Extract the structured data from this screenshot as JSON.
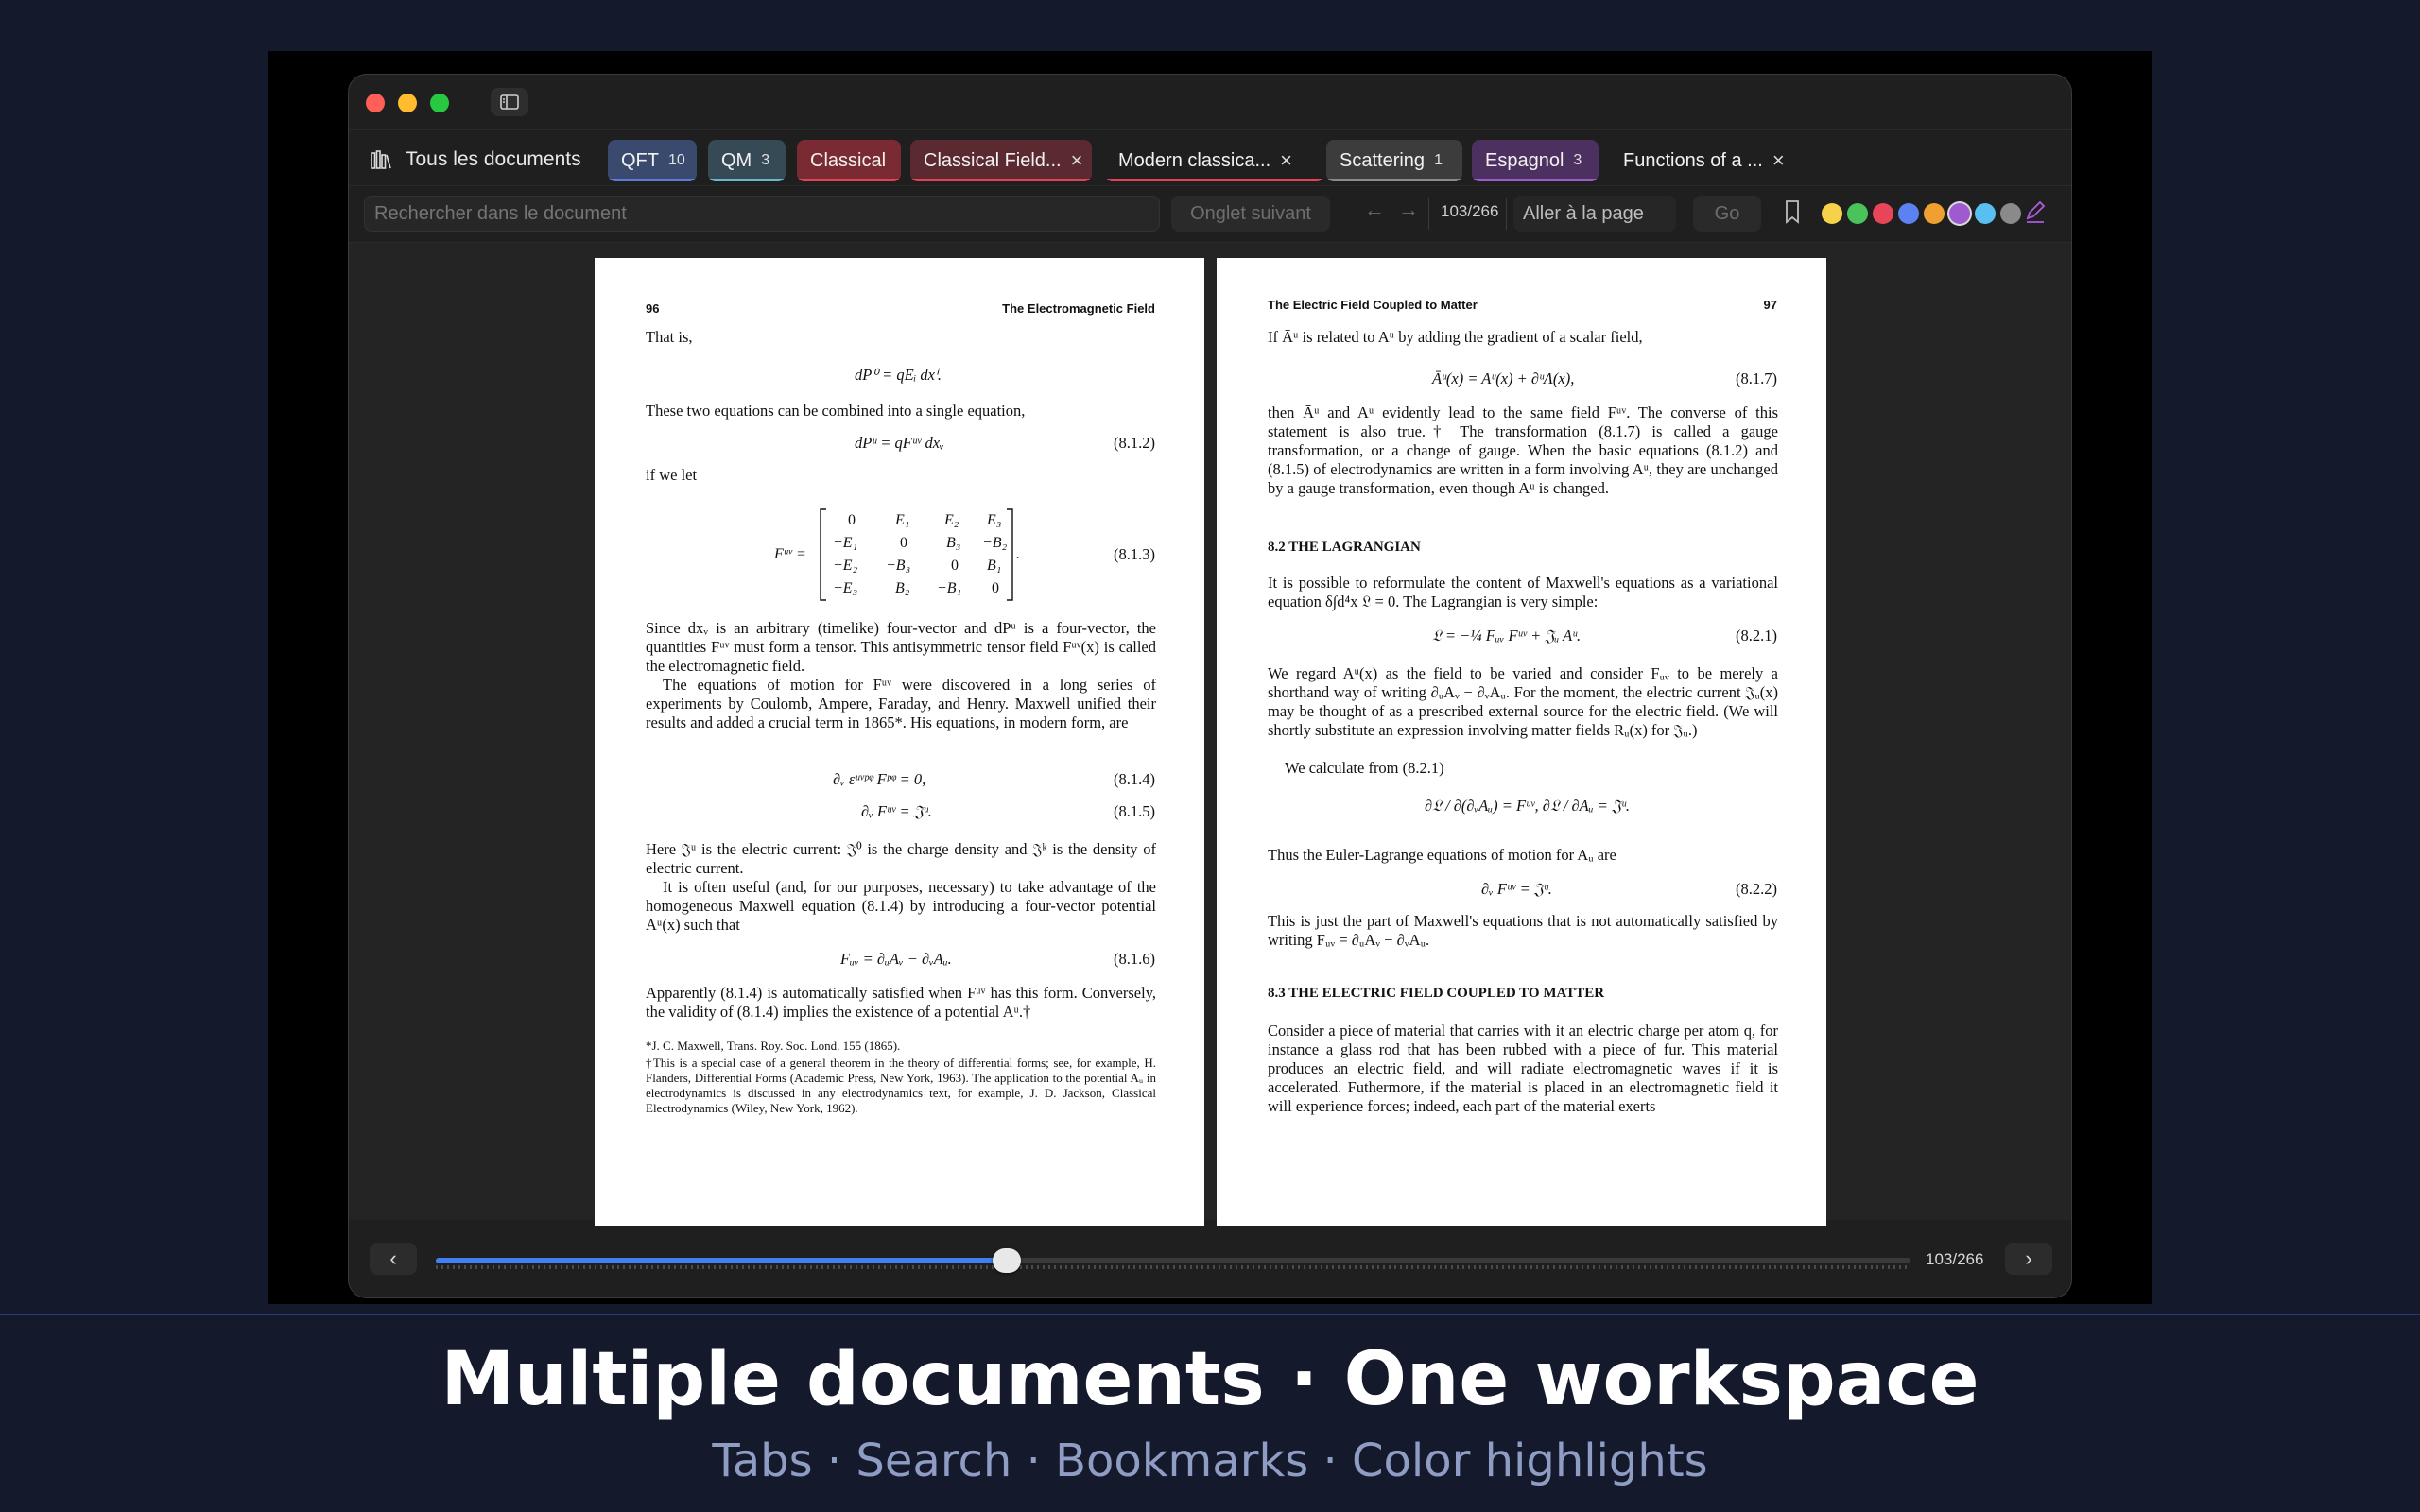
{
  "window": {
    "tabs_bar": {
      "all_docs_label": "Tous les documents",
      "tabs": [
        {
          "label": "QFT",
          "count": "10",
          "color": "#3a4a6e",
          "underline": "#5d7bd8"
        },
        {
          "label": "QM",
          "count": "3",
          "color": "#364a55",
          "underline": "#6ab8cf"
        },
        {
          "label": "Classical",
          "color": "#7a2a32",
          "underline": "#e04455"
        },
        {
          "label": "Classical Field...",
          "close": "×",
          "color": "#5a2a30",
          "underline": "#e04455"
        },
        {
          "label": "Modern classica...",
          "close": "×",
          "color": "transparent",
          "underline": "#e04455"
        },
        {
          "label": "Scattering",
          "count": "1",
          "color": "#3c3c3c",
          "underline": "#8a8a8a"
        },
        {
          "label": "Espagnol",
          "count": "3",
          "color": "#4c3060",
          "underline": "#a05ad0"
        },
        {
          "label": "Functions of a ...",
          "close": "×",
          "color": "transparent",
          "underline": "transparent"
        }
      ]
    },
    "toolbar": {
      "search_placeholder": "Rechercher dans le document",
      "next_tab_label": "Onglet suivant",
      "page_count": "103/266",
      "goto_placeholder": "Aller à la page",
      "go_label": "Go",
      "highlight_colors": [
        "#f5d24a",
        "#4cc35a",
        "#e8445a",
        "#5b82f0",
        "#f0a030",
        "#a05ad0",
        "#58c0f0",
        "#8a8a8a"
      ],
      "selected_color_index": 5
    },
    "pages": {
      "left": {
        "number": "96",
        "running_head": "The Electromagnetic Field",
        "t1": "That is,",
        "eq1": "dP⁰ = qEᵢ dxⁱ.",
        "t2": "These two equations can be combined into a single equation,",
        "eq2": "dPᵘ = qFᵘᵛ dxᵥ",
        "eq2n": "(8.1.2)",
        "t3": "if we let",
        "eq3n": "(8.1.3)",
        "t4": "Since dxᵥ is an arbitrary (timelike) four-vector and dPᵘ is a four-vector, the quantities Fᵘᵛ must form a tensor. This antisymmetric tensor field Fᵘᵛ(x) is called the electromagnetic field.",
        "t5": "The equations of motion for Fᵘᵛ were discovered in a long series of experiments by Coulomb, Ampere, Faraday, and Henry. Maxwell unified their results and added a crucial term in 1865*. His equations, in modern form, are",
        "eq4": "∂ᵥ εᵘᵛᵖᵠ Fᵖᵠ = 0,",
        "eq4n": "(8.1.4)",
        "eq5": "∂ᵥ Fᵘᵛ = 𝔍ᵘ.",
        "eq5n": "(8.1.5)",
        "t6": "Here 𝔍ᵘ is the electric current: 𝔍⁰ is the charge density and 𝔍ᵏ is the density of electric current.",
        "t7": "It is often useful (and, for our purposes, necessary) to take advantage of the homogeneous Maxwell equation (8.1.4) by introducing a four-vector potential Aᵘ(x) such that",
        "eq6": "Fᵤᵥ = ∂ᵤAᵥ − ∂ᵥAᵤ.",
        "eq6n": "(8.1.6)",
        "t8": "Apparently (8.1.4) is automatically satisfied when Fᵘᵛ has this form. Conversely, the validity of (8.1.4) implies the existence of a potential Aᵘ.†",
        "fn1": "*J. C. Maxwell, Trans. Roy. Soc. Lond. 155 (1865).",
        "fn2": "†This is a special case of a general theorem in the theory of differential forms; see, for example, H. Flanders, Differential Forms (Academic Press, New York, 1963). The application to the potential Aᵤ in electrodynamics is discussed in any electrodynamics text, for example, J. D. Jackson, Classical Electrodynamics (Wiley, New York, 1962)."
      },
      "right": {
        "number": "97",
        "running_head": "The Electric Field Coupled to Matter",
        "t1": "If Āᵘ is related to Aᵘ by adding the gradient of a scalar field,",
        "eq1": "Āᵘ(x) = Aᵘ(x) + ∂ᵘΛ(x),",
        "eq1n": "(8.1.7)",
        "t2": "then Āᵘ and Aᵘ evidently lead to the same field Fᵘᵛ. The converse of this statement is also true.† The transformation (8.1.7) is called a gauge transformation, or a change of gauge. When the basic equations (8.1.2) and (8.1.5) of electrodynamics are written in a form involving Aᵘ, they are unchanged by a gauge transformation, even though Aᵘ is changed.",
        "s1": "8.2   THE LAGRANGIAN",
        "t3": "It is possible to reformulate the content of Maxwell's equations as a variational equation δ∫d⁴x 𝔏 = 0. The Lagrangian is very simple:",
        "eq2": "𝔏 = −¼ Fᵤᵥ Fᵘᵛ + 𝔍ᵤ Aᵘ.",
        "eq2n": "(8.2.1)",
        "t4": "We regard Aᵘ(x) as the field to be varied and consider Fᵤᵥ to be merely a shorthand way of writing ∂ᵤAᵥ − ∂ᵥAᵤ. For the moment, the electric current 𝔍ᵤ(x) may be thought of as a prescribed external source for the electric field. (We will shortly substitute an expression involving matter fields Rᵤ(x) for 𝔍ᵤ.)",
        "t5": "We calculate from (8.2.1)",
        "eq3": "∂𝔏 / ∂(∂ᵥAᵤ) = Fᵘᵛ,    ∂𝔏 / ∂Aᵤ = 𝔍ᵘ.",
        "t6": "Thus the Euler-Lagrange equations of motion for Aᵤ are",
        "eq4": "∂ᵥ Fᵘᵛ = 𝔍ᵘ.",
        "eq4n": "(8.2.2)",
        "t7": "This is just the part of Maxwell's equations that is not automatically satisfied by writing Fᵤᵥ = ∂ᵤAᵥ − ∂ᵥAᵤ.",
        "s2": "8.3   THE ELECTRIC FIELD COUPLED TO MATTER",
        "t8": "Consider a piece of material that carries with it an electric charge per atom q, for instance a glass rod that has been rubbed with a piece of fur. This material produces an electric field, and will radiate electromagnetic waves if it is accelerated. Futhermore, if the material is placed in an electromagnetic field it will experience forces; indeed, each part of the material exerts"
      }
    },
    "bottom": {
      "prev": "‹",
      "next": "›",
      "page_label": "103/266",
      "progress": 0.387
    }
  },
  "caption": {
    "title": "Multiple documents · One workspace",
    "subtitle": "Tabs · Search · Bookmarks · Color highlights"
  }
}
